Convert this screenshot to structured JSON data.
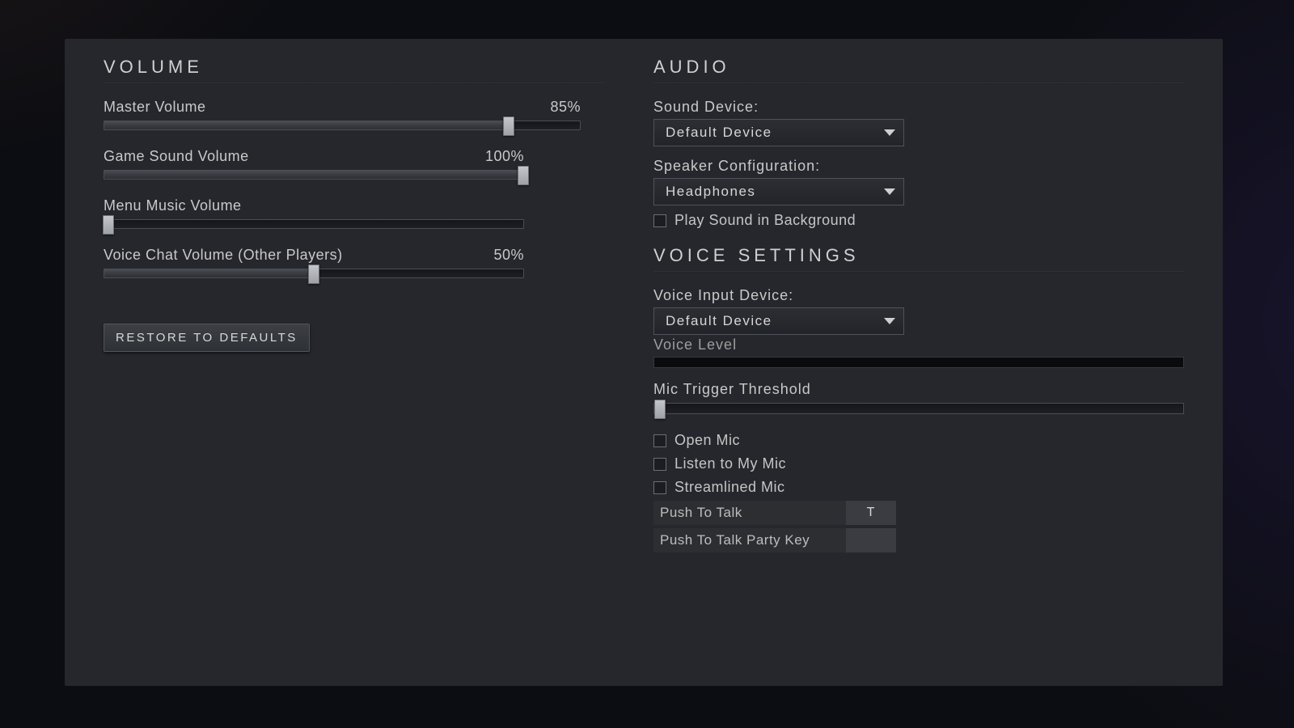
{
  "volume": {
    "title": "VOLUME",
    "sliders": {
      "master": {
        "label": "Master Volume",
        "value_text": "85%",
        "percent": 85
      },
      "game": {
        "label": "Game Sound Volume",
        "value_text": "100%",
        "percent": 100
      },
      "menu_music": {
        "label": "Menu Music Volume",
        "value_text": "",
        "percent": 1
      },
      "voice_chat": {
        "label": "Voice Chat Volume (Other Players)",
        "value_text": "50%",
        "percent": 50
      }
    },
    "restore_button": "RESTORE TO DEFAULTS"
  },
  "audio": {
    "title": "AUDIO",
    "sound_device_label": "Sound Device:",
    "sound_device_value": "Default Device",
    "speaker_config_label": "Speaker Configuration:",
    "speaker_config_value": "Headphones",
    "play_bg_label": "Play Sound in Background",
    "play_bg_checked": false
  },
  "voice": {
    "title": "VOICE SETTINGS",
    "input_device_label": "Voice Input Device:",
    "input_device_value": "Default Device",
    "voice_level_label": "Voice Level",
    "mic_threshold_label": "Mic Trigger Threshold",
    "mic_threshold_percent": 1,
    "open_mic_label": "Open Mic",
    "listen_mic_label": "Listen to My Mic",
    "streamlined_mic_label": "Streamlined Mic",
    "ptt_label": "Push To Talk",
    "ptt_key": "T",
    "ptt_party_label": "Push To Talk Party Key",
    "ptt_party_key": ""
  }
}
